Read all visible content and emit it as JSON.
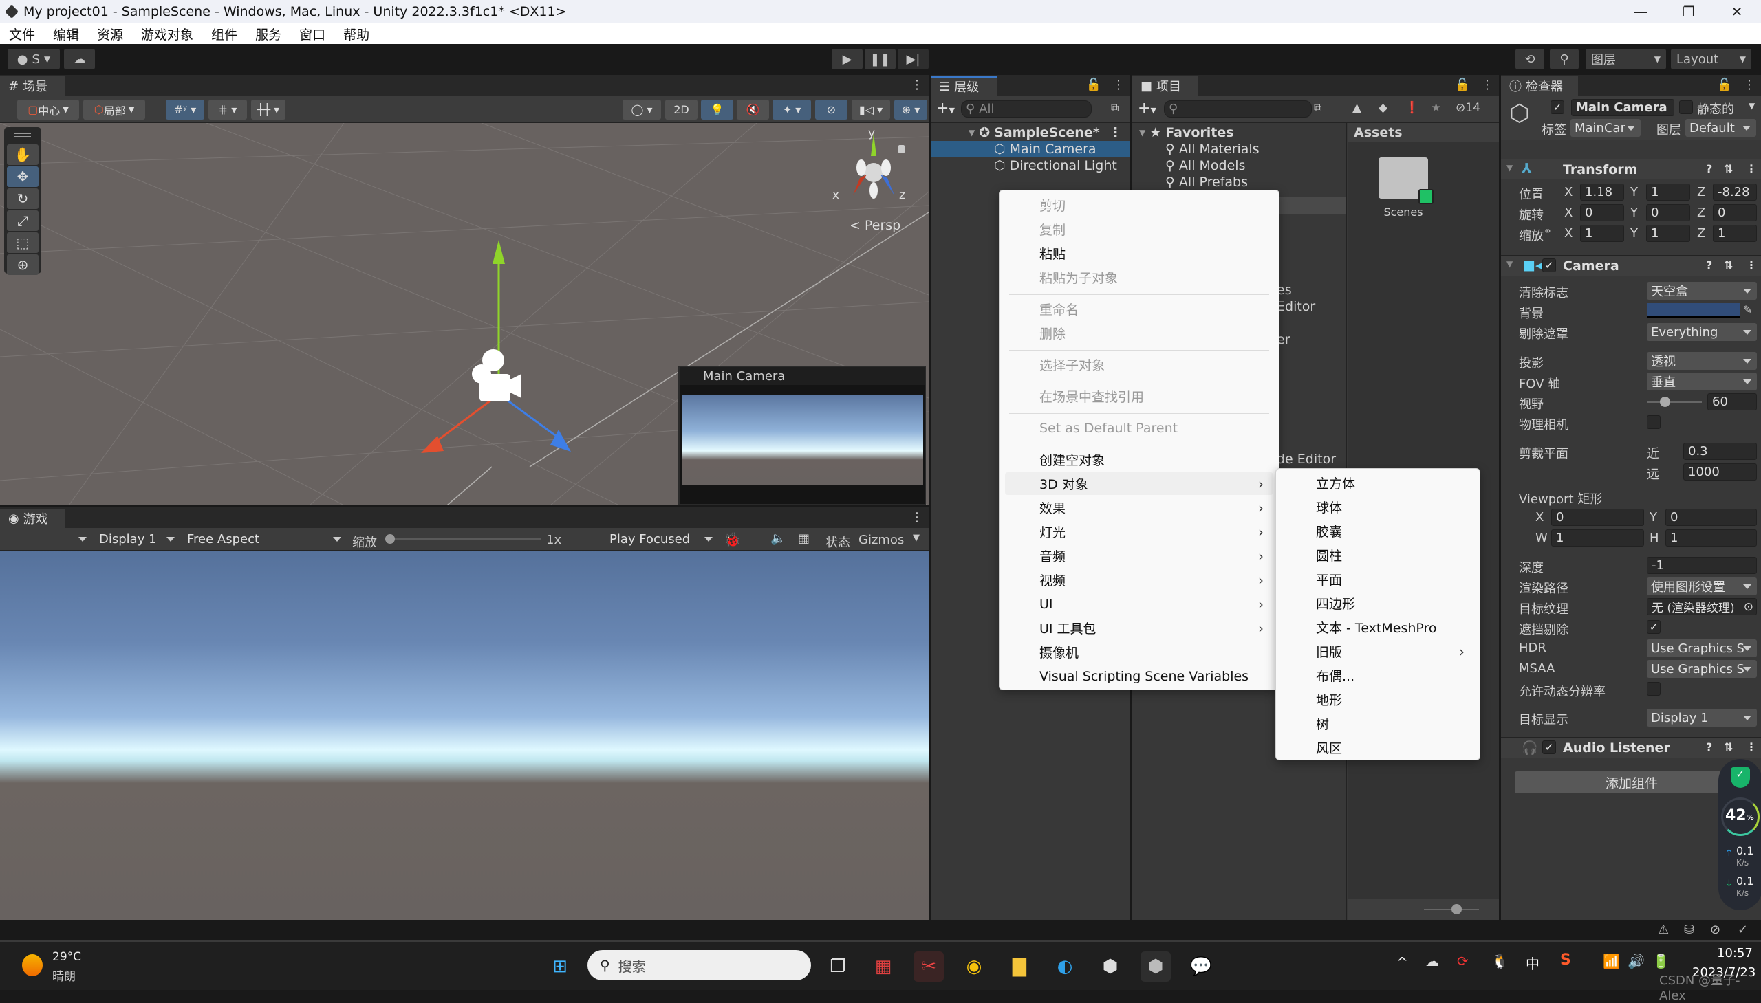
{
  "window": {
    "title": "My project01 - SampleScene - Windows, Mac, Linux - Unity 2022.3.3f1c1* <DX11>",
    "minimize": "—",
    "maximize": "❐",
    "close": "✕"
  },
  "menubar": [
    "文件",
    "编辑",
    "资源",
    "游戏对象",
    "组件",
    "服务",
    "窗口",
    "帮助"
  ],
  "toolbar": {
    "account_label": "S",
    "play": "▶",
    "pause": "❚❚",
    "step": "▶|",
    "layers_label": "图层",
    "layout_label": "Layout"
  },
  "scene": {
    "tab_label": "场景",
    "pivot_label": "中心",
    "space_label": "局部",
    "mode_2d": "2D",
    "persp_label": "Persp",
    "gizmo_axes": {
      "x": "x",
      "y": "y",
      "z": "z"
    },
    "camera_preview_title": "Main Camera"
  },
  "game": {
    "tab_label": "游戏",
    "display": "Display 1",
    "aspect": "Free Aspect",
    "scale_label": "缩放",
    "scale_value": "1x",
    "play_mode": "Play Focused",
    "stats_label": "状态",
    "gizmos_label": "Gizmos"
  },
  "hierarchy": {
    "tab_label": "层级",
    "search_placeholder": "All",
    "scene_name": "SampleScene*",
    "items": [
      {
        "label": "Main Camera",
        "selected": true
      },
      {
        "label": "Directional Light",
        "selected": false
      }
    ]
  },
  "project": {
    "tab_label": "项目",
    "hidden_count": "14",
    "favorites_label": "Favorites",
    "favorites": [
      "All Materials",
      "All Models",
      "All Prefabs"
    ],
    "partial_tree_text": [
      "es",
      "Editor",
      "er",
      "de Editor"
    ],
    "assets_header": "Assets",
    "assets": [
      {
        "name": "Scenes"
      }
    ]
  },
  "inspector": {
    "tab_label": "检查器",
    "object_name": "Main Camera",
    "object_active": true,
    "static_label": "静态的",
    "tag_label": "标签",
    "tag_value": "MainCar",
    "layer_label": "图层",
    "layer_value": "Default",
    "transform": {
      "title": "Transform",
      "position_label": "位置",
      "rotation_label": "旋转",
      "scale_label": "缩放",
      "position": {
        "x": "1.18",
        "y": "1",
        "z": "-8.28"
      },
      "rotation": {
        "x": "0",
        "y": "0",
        "z": "0"
      },
      "scale": {
        "x": "1",
        "y": "1",
        "z": "1"
      }
    },
    "camera": {
      "title": "Camera",
      "enabled": true,
      "clear_flags_label": "清除标志",
      "clear_flags": "天空盒",
      "background_label": "背景",
      "background_color": "#314d79",
      "culling_mask_label": "剔除遮罩",
      "culling_mask": "Everything",
      "projection_label": "投影",
      "projection": "透视",
      "fov_axis_label": "FOV 轴",
      "fov_axis": "垂直",
      "fov_label": "视野",
      "fov_value": "60",
      "fov_slider_fraction": 0.33,
      "physical_camera_label": "物理相机",
      "physical_camera": false,
      "clipping_label": "剪裁平面",
      "near_label": "近",
      "near": "0.3",
      "far_label": "远",
      "far": "1000",
      "viewport_label": "Viewport 矩形",
      "viewport": {
        "x": "0",
        "y": "0",
        "w": "1",
        "h": "1"
      },
      "depth_label": "深度",
      "depth": "-1",
      "render_path_label": "渲染路径",
      "render_path": "使用图形设置",
      "target_texture_label": "目标纹理",
      "target_texture": "无 (渲染器纹理)",
      "occlusion_label": "遮挡剔除",
      "occlusion": true,
      "hdr_label": "HDR",
      "hdr": "Use Graphics S",
      "msaa_label": "MSAA",
      "msaa": "Use Graphics S",
      "dynamic_res_label": "允许动态分辨率",
      "dynamic_res": false,
      "target_display_label": "目标显示",
      "target_display": "Display 1"
    },
    "audio_listener": {
      "title": "Audio Listener",
      "enabled": true
    },
    "add_component": "添加组件"
  },
  "context_menu": {
    "items": [
      {
        "label": "剪切",
        "disabled": true
      },
      {
        "label": "复制",
        "disabled": true
      },
      {
        "label": "粘贴",
        "disabled": false
      },
      {
        "label": "粘贴为子对象",
        "disabled": true
      },
      {
        "sep": true
      },
      {
        "label": "重命名",
        "disabled": true
      },
      {
        "label": "删除",
        "disabled": true
      },
      {
        "sep": true
      },
      {
        "label": "选择子对象",
        "disabled": true
      },
      {
        "sep": true
      },
      {
        "label": "在场景中查找引用",
        "disabled": true
      },
      {
        "sep": true
      },
      {
        "label": "Set as Default Parent",
        "disabled": true
      },
      {
        "sep": true
      },
      {
        "label": "创建空对象",
        "disabled": false
      },
      {
        "label": "3D 对象",
        "submenu": true,
        "highlighted": true
      },
      {
        "label": "效果",
        "submenu": true
      },
      {
        "label": "灯光",
        "submenu": true
      },
      {
        "label": "音频",
        "submenu": true
      },
      {
        "label": "视频",
        "submenu": true
      },
      {
        "label": "UI",
        "submenu": true
      },
      {
        "label": "UI 工具包",
        "submenu": true
      },
      {
        "label": "摄像机",
        "submenu": false
      },
      {
        "label": "Visual Scripting Scene Variables",
        "submenu": false
      }
    ],
    "submenu_items": [
      {
        "label": "立方体"
      },
      {
        "label": "球体"
      },
      {
        "label": "胶囊"
      },
      {
        "label": "圆柱"
      },
      {
        "label": "平面"
      },
      {
        "label": "四边形"
      },
      {
        "label": "文本 - TextMeshPro"
      },
      {
        "label": "旧版",
        "submenu": true
      },
      {
        "label": "布偶..."
      },
      {
        "label": "地形"
      },
      {
        "label": "树"
      },
      {
        "label": "风区"
      }
    ]
  },
  "overlay_widget": {
    "cpu_percent": "42",
    "percent_sign": "%",
    "upload": "0.1",
    "download": "0.1",
    "rate_unit": "K/s"
  },
  "taskbar": {
    "weather_temp": "29°C",
    "weather_desc": "晴朗",
    "search_placeholder": "搜索",
    "ime": "中",
    "time": "10:57",
    "date": "2023/7/23",
    "watermark": "CSDN @量子-Alex"
  }
}
